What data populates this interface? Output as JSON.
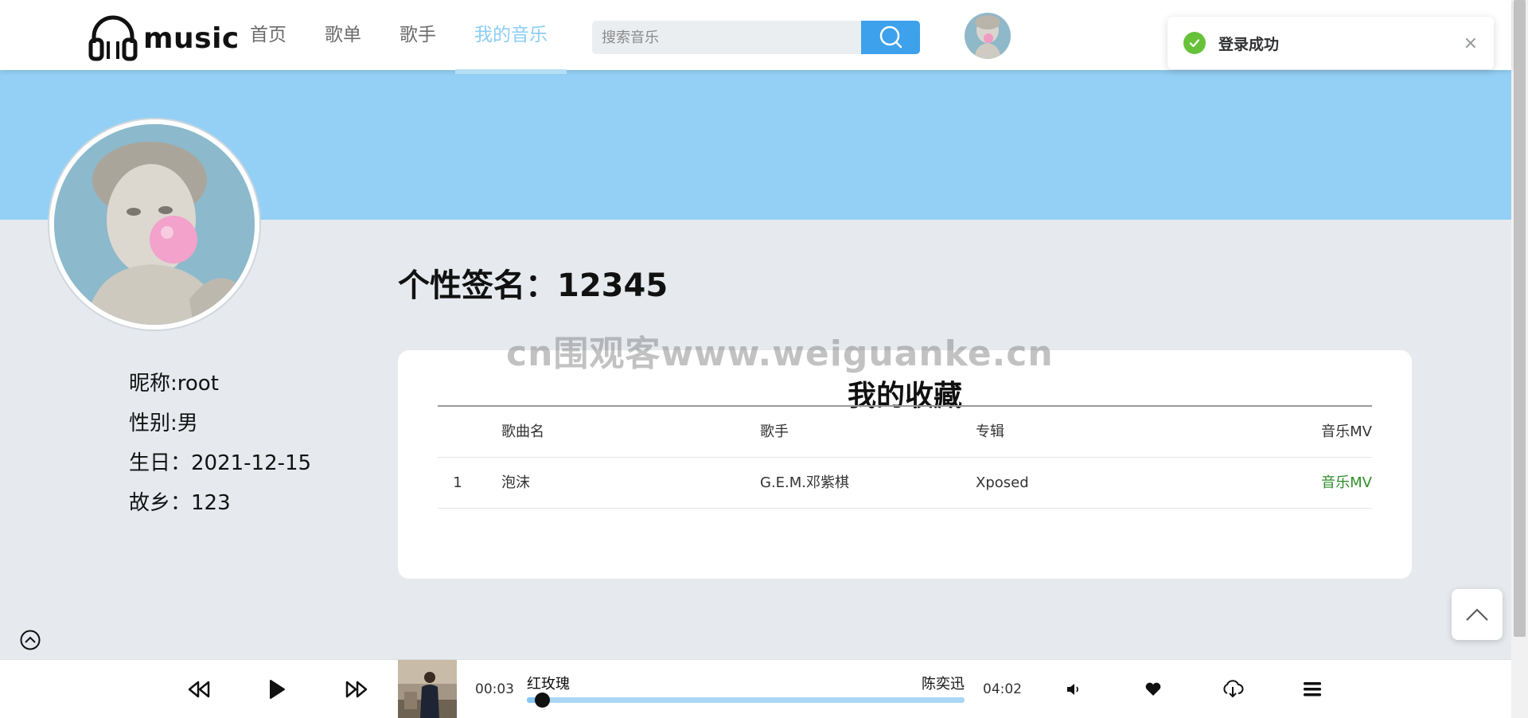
{
  "header": {
    "logo_text": "music",
    "nav": [
      {
        "label": "首页",
        "active": false
      },
      {
        "label": "歌单",
        "active": false
      },
      {
        "label": "歌手",
        "active": false
      },
      {
        "label": "我的音乐",
        "active": true
      }
    ],
    "search_placeholder": "搜索音乐",
    "search_value": ""
  },
  "toast": {
    "message": "登录成功",
    "close_glyph": "×",
    "type": "success"
  },
  "profile": {
    "signature": "个性签名：12345",
    "nickname": "昵称:root",
    "gender": "性别:男",
    "birthday": "生日：2021-12-15",
    "hometown": "故乡：123"
  },
  "watermark": "cn围观客www.weiguanke.cn",
  "favorites": {
    "title": "我的收藏",
    "columns": {
      "song": "歌曲名",
      "artist": "歌手",
      "album": "专辑",
      "mv": "音乐MV"
    },
    "rows": [
      {
        "index": "1",
        "song": "泡沫",
        "artist": "G.E.M.邓紫棋",
        "album": "Xposed",
        "mv": "音乐MV"
      }
    ]
  },
  "player": {
    "current_time": "00:03",
    "total_time": "04:02",
    "song": "红玫瑰",
    "artist": "陈奕迅",
    "progress_fraction": 0.035
  },
  "colors": {
    "accent": "#3ea1ec",
    "banner": "#94d0f5",
    "nav_active": "#8dcdf5",
    "mv_link": "#2f8d2a",
    "success": "#67c23a"
  },
  "icons": [
    "headphones-icon",
    "search-icon",
    "check-icon",
    "close-icon",
    "chevron-up-icon",
    "collapse-up-icon",
    "previous-icon",
    "play-icon",
    "next-icon",
    "volume-icon",
    "heart-icon",
    "download-icon",
    "playlist-icon"
  ]
}
